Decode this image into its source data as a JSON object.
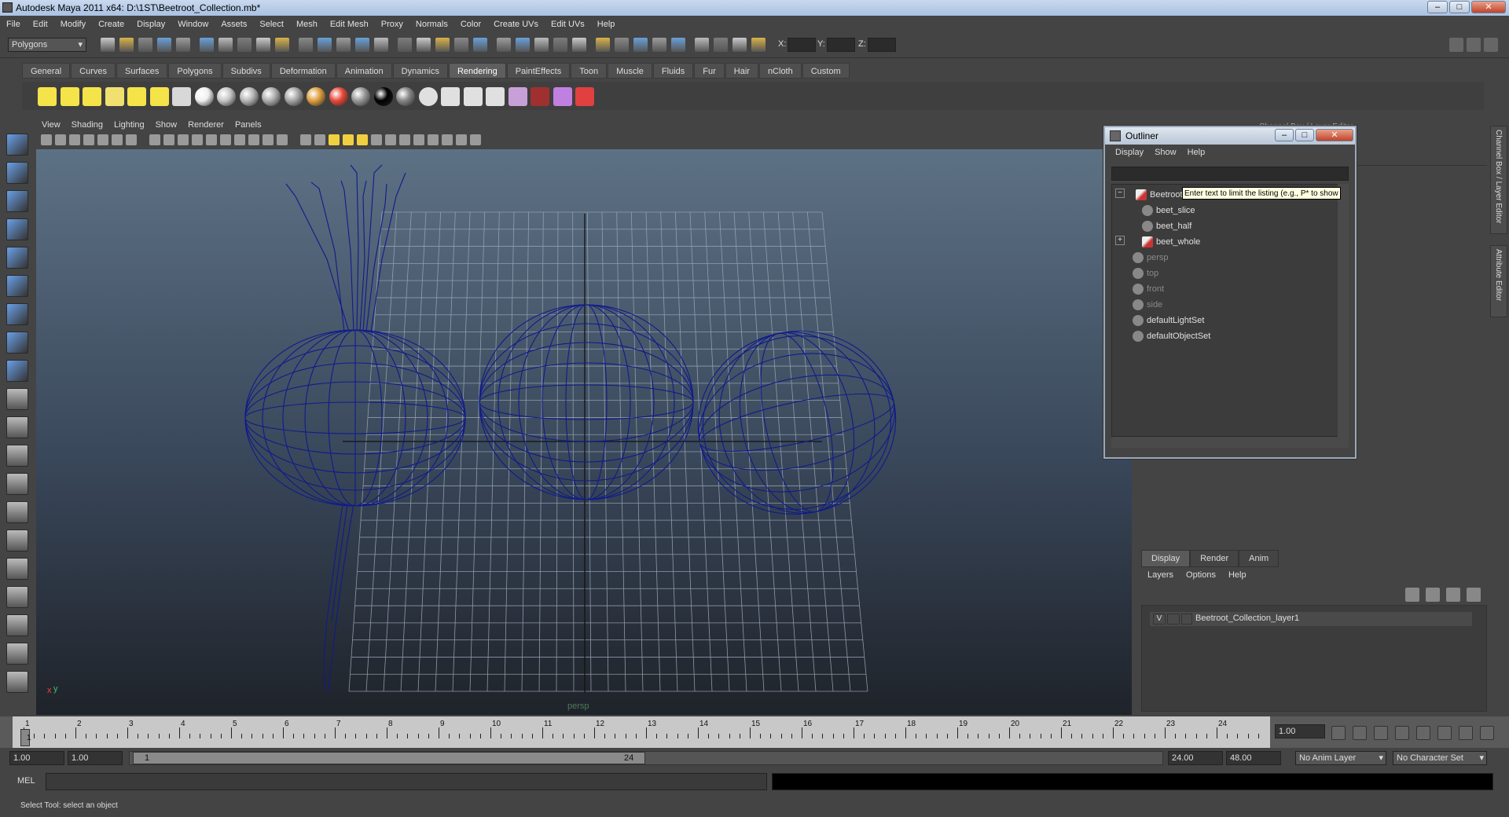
{
  "window": {
    "title": "Autodesk Maya 2011 x64: D:\\1ST\\Beetroot_Collection.mb*"
  },
  "menubar": [
    "File",
    "Edit",
    "Modify",
    "Create",
    "Display",
    "Window",
    "Assets",
    "Select",
    "Mesh",
    "Edit Mesh",
    "Proxy",
    "Normals",
    "Color",
    "Create UVs",
    "Edit UVs",
    "Help"
  ],
  "statusline": {
    "mode": "Polygons",
    "x_label": "X:",
    "y_label": "Y:",
    "z_label": "Z:"
  },
  "shelf_tabs": [
    "General",
    "Curves",
    "Surfaces",
    "Polygons",
    "Subdivs",
    "Deformation",
    "Animation",
    "Dynamics",
    "Rendering",
    "PaintEffects",
    "Toon",
    "Muscle",
    "Fluids",
    "Fur",
    "Hair",
    "nCloth",
    "Custom"
  ],
  "active_shelf_tab": "Rendering",
  "viewport": {
    "menus": [
      "View",
      "Shading",
      "Lighting",
      "Show",
      "Renderer",
      "Panels"
    ],
    "camera_label": "persp",
    "axis_x": "x",
    "axis_y": "y"
  },
  "outliner": {
    "title": "Outliner",
    "menus": [
      "Display",
      "Show",
      "Help"
    ],
    "tooltip": "Enter text to limit the listing (e.g., P* to show",
    "items": [
      {
        "label": "Beetroot_Collection",
        "expand": "−",
        "dim": false
      },
      {
        "label": "beet_slice",
        "dim": false
      },
      {
        "label": "beet_half",
        "dim": false
      },
      {
        "label": "beet_whole",
        "expand": "+",
        "dim": false
      },
      {
        "label": "persp",
        "dim": true
      },
      {
        "label": "top",
        "dim": true
      },
      {
        "label": "front",
        "dim": true
      },
      {
        "label": "side",
        "dim": true
      },
      {
        "label": "defaultLightSet",
        "dim": false
      },
      {
        "label": "defaultObjectSet",
        "dim": false
      }
    ]
  },
  "channel_box": {
    "title": "Channel Box / Layer Editor"
  },
  "side_tabs": [
    "Channel Box / Layer Editor",
    "Attribute Editor"
  ],
  "layer_editor": {
    "tabs": [
      "Display",
      "Render",
      "Anim"
    ],
    "active_tab": "Display",
    "menus": [
      "Layers",
      "Options",
      "Help"
    ],
    "layer": {
      "visible": "V",
      "name": "Beetroot_Collection_layer1"
    }
  },
  "time_slider": {
    "ticks": [
      "1",
      "2",
      "3",
      "4",
      "5",
      "6",
      "7",
      "8",
      "9",
      "10",
      "11",
      "12",
      "13",
      "14",
      "15",
      "16",
      "17",
      "18",
      "19",
      "20",
      "21",
      "22",
      "23",
      "24"
    ],
    "current_frame": "1",
    "current_time_field": "1.00"
  },
  "range_slider": {
    "start_time": "1.00",
    "playback_start": "1.00",
    "range_start_label": "1",
    "range_end_label": "24",
    "playback_end": "24.00",
    "end_time": "48.00",
    "anim_layer": "No Anim Layer",
    "character_set": "No Character Set"
  },
  "command_line": {
    "label": "MEL"
  },
  "help_line": {
    "text": "Select Tool: select an object"
  }
}
